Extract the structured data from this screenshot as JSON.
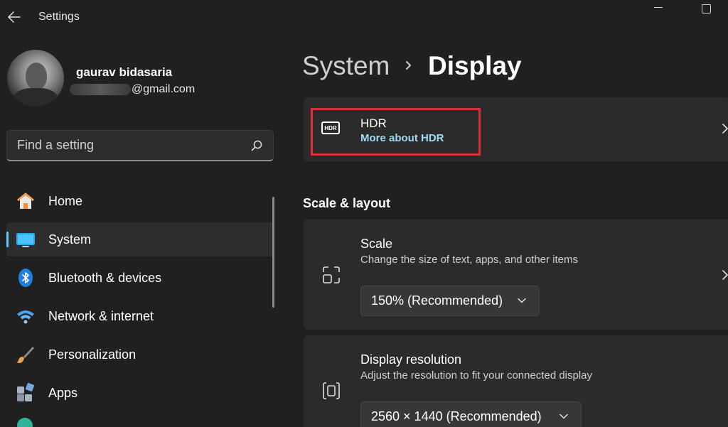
{
  "window": {
    "title": "Settings"
  },
  "profile": {
    "name": "gaurav bidasaria",
    "email_domain": "@gmail.com"
  },
  "search": {
    "placeholder": "Find a setting"
  },
  "nav": {
    "items": [
      {
        "label": "Home",
        "icon": "home-icon"
      },
      {
        "label": "System",
        "icon": "monitor-icon",
        "active": true
      },
      {
        "label": "Bluetooth & devices",
        "icon": "bluetooth-icon"
      },
      {
        "label": "Network & internet",
        "icon": "wifi-icon"
      },
      {
        "label": "Personalization",
        "icon": "brush-icon"
      },
      {
        "label": "Apps",
        "icon": "apps-icon"
      }
    ]
  },
  "breadcrumb": {
    "parent": "System",
    "current": "Display"
  },
  "hdr": {
    "title": "HDR",
    "link": "More about HDR",
    "icon_text": "HDR"
  },
  "scale_layout": {
    "section_title": "Scale & layout",
    "scale": {
      "title": "Scale",
      "description": "Change the size of text, apps, and other items",
      "value": "150% (Recommended)"
    },
    "resolution": {
      "title": "Display resolution",
      "description": "Adjust the resolution to fit your connected display",
      "value": "2560 × 1440 (Recommended)"
    }
  },
  "colors": {
    "accent": "#60cdff",
    "highlight_border": "#d9303a",
    "link": "#9edbf4",
    "background": "#202020",
    "card": "#2b2b2b"
  }
}
